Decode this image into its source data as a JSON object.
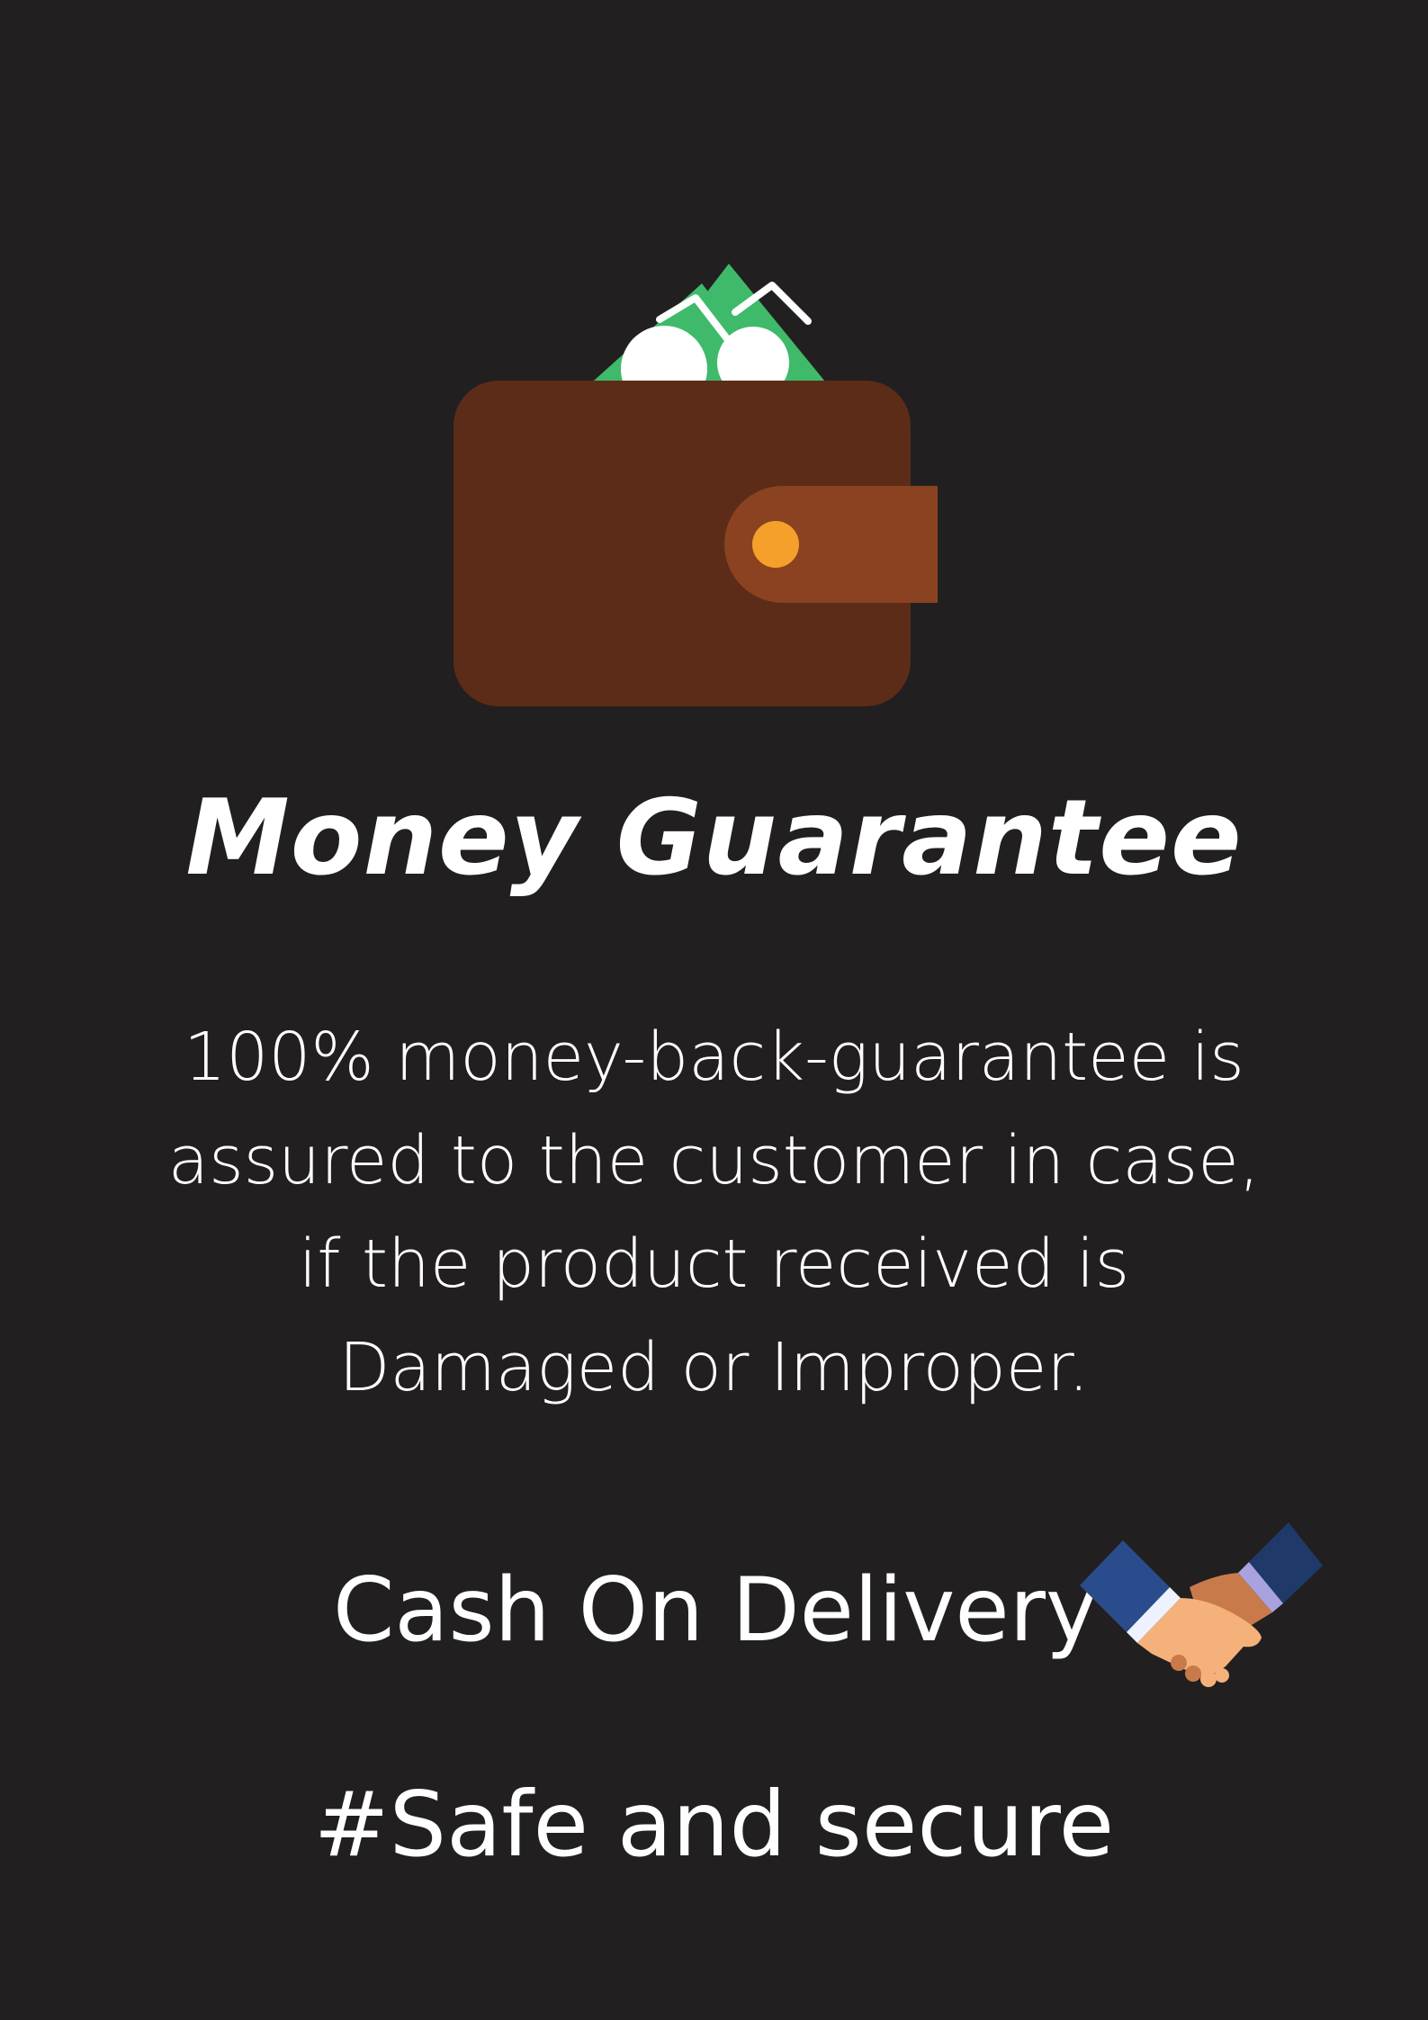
{
  "illustration": {
    "icon": "wallet-icon",
    "colors": {
      "wallet_body": "#5c2c18",
      "wallet_strap": "#8b4220",
      "wallet_button": "#f4a02a",
      "bill": "#3fba6a",
      "bill_mark": "#ffffff"
    }
  },
  "title": "Money Guarantee",
  "description": {
    "lines": [
      "100% money-back-guarantee is",
      "assured to the customer in case,",
      "if the product received is",
      "Damaged or Improper."
    ]
  },
  "cod": {
    "label": "Cash On Delivery",
    "icon": "handshake-icon",
    "colors": {
      "sleeve": "#2b4c8c",
      "sleeve_dark": "#1f3a68",
      "cuff_left": "#eef2ff",
      "cuff_right": "#a9a2e0",
      "skin_light": "#f4b27a",
      "skin_dark": "#c97a4a"
    }
  },
  "tagline": "#Safe and secure",
  "colors": {
    "background": "#221f20",
    "text": "#ffffff"
  }
}
